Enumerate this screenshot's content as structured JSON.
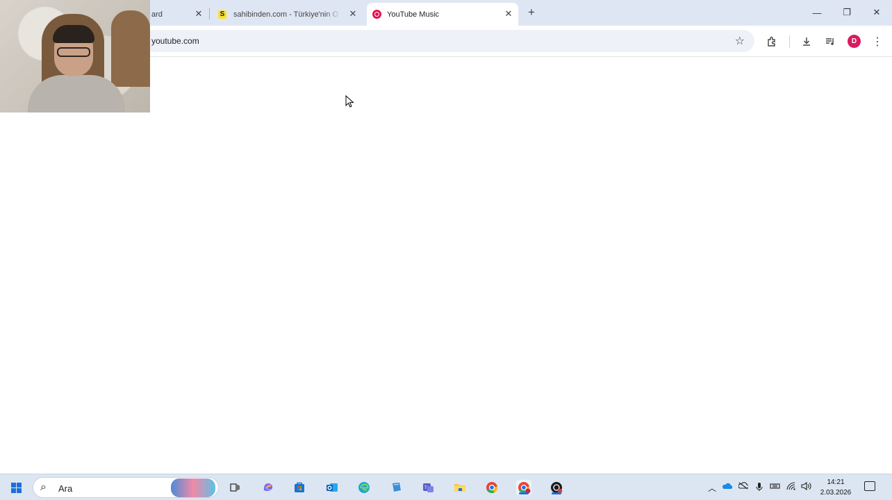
{
  "browser": {
    "tabs": [
      {
        "title": "ard",
        "favicon": "dashboard-icon"
      },
      {
        "title": "sahibinden.com - Türkiye'nin O",
        "favicon_letter": "S"
      },
      {
        "title": "YouTube Music",
        "favicon": "youtube-music-icon",
        "active": true
      }
    ],
    "new_tab_label": "+",
    "window_controls": {
      "minimize": "—",
      "restore": "❐",
      "close": "✕"
    },
    "address": "youtube.com",
    "profile_initial": "D",
    "profile_color": "#d81b60"
  },
  "taskbar": {
    "search_placeholder": "Ara",
    "clock_time": "14:21",
    "clock_date": "2.03.2026",
    "accent_color": "#1e6fd9"
  }
}
